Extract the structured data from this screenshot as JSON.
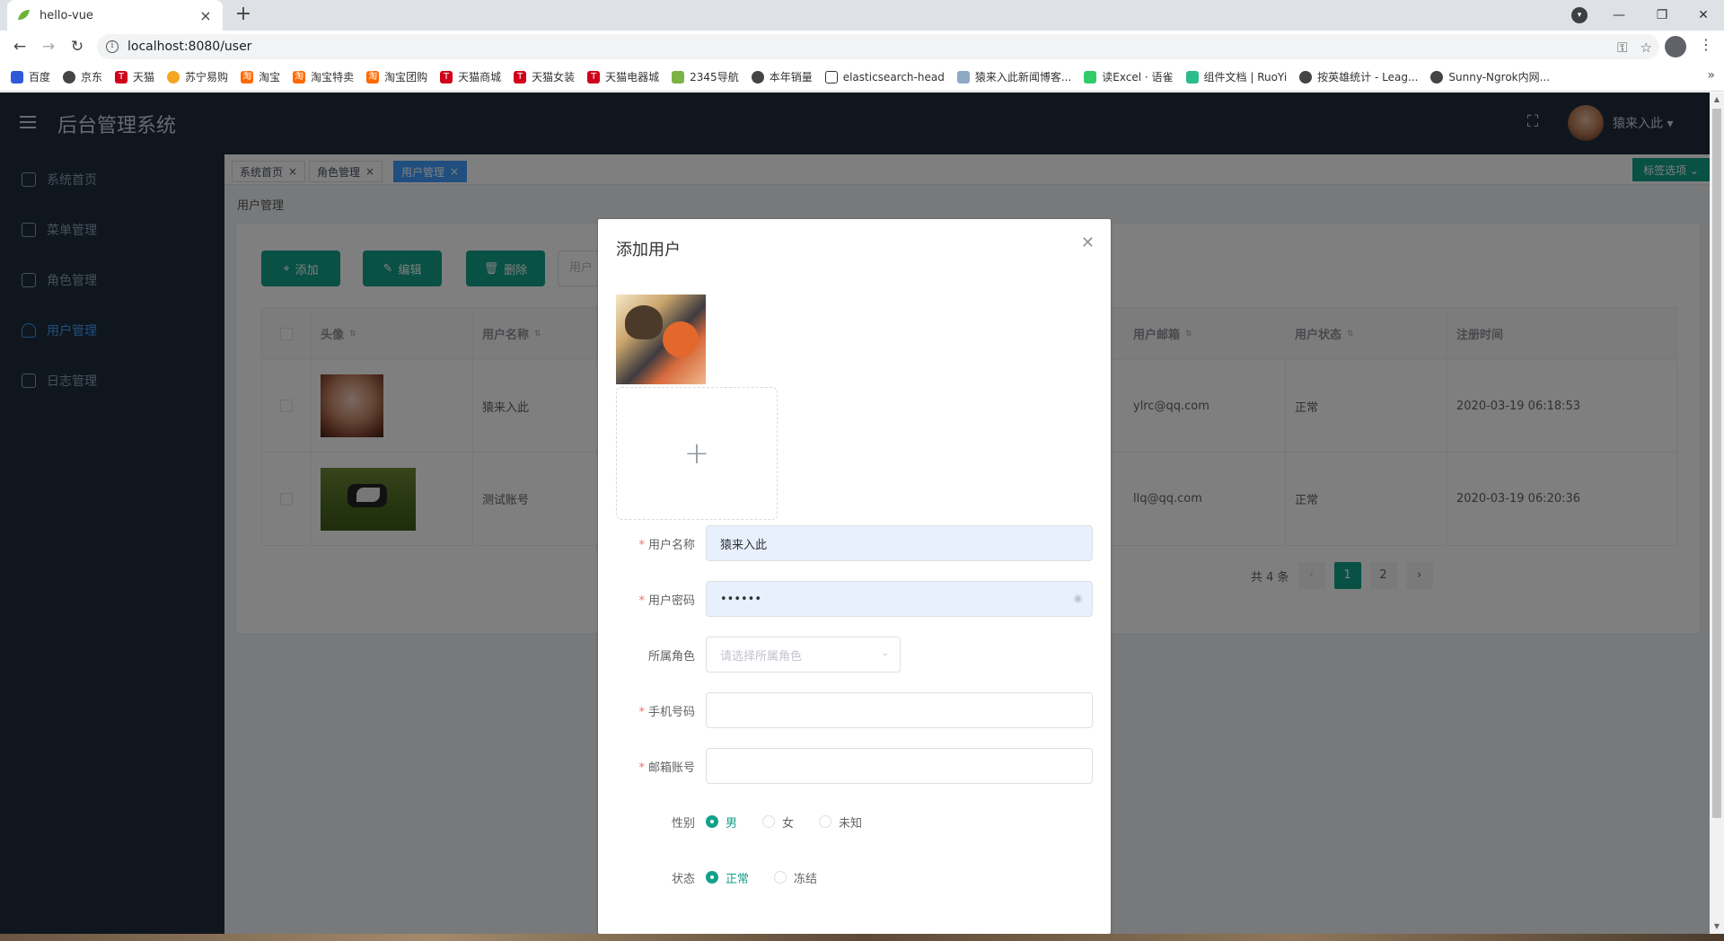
{
  "browser": {
    "tab_title": "hello-vue",
    "url": "localhost:8080/user",
    "bookmarks": [
      "百度",
      "京东",
      "天猫",
      "苏宁易购",
      "淘宝",
      "淘宝特卖",
      "淘宝团购",
      "天猫商城",
      "天猫女装",
      "天猫电器城",
      "2345导航",
      "本年销量",
      "elasticsearch-head",
      "猿来入此新闻博客...",
      "读Excel · 语雀",
      "组件文档 | RuoYi",
      "按英雄统计 - Leag...",
      "Sunny-Ngrok内网..."
    ]
  },
  "app": {
    "title": "后台管理系统",
    "user_name": "猿来入此 ▾"
  },
  "sidebar": {
    "items": [
      {
        "label": "系统首页"
      },
      {
        "label": "菜单管理"
      },
      {
        "label": "角色管理"
      },
      {
        "label": "用户管理"
      },
      {
        "label": "日志管理"
      }
    ]
  },
  "tags": {
    "items": [
      {
        "label": "系统首页"
      },
      {
        "label": "角色管理"
      },
      {
        "label": "用户管理"
      }
    ],
    "options_label": "标签选项 ⌄"
  },
  "page": {
    "breadcrumb": "用户管理",
    "buttons": {
      "add": "添加",
      "edit": "编辑",
      "delete": "删除"
    },
    "search_stub": "用户",
    "table": {
      "headers": [
        "头像",
        "用户名称",
        "用户邮箱",
        "用户状态",
        "注册时间"
      ],
      "rows": [
        {
          "name": "猿来入此",
          "email": "ylrc@qq.com",
          "status": "正常",
          "time": "2020-03-19 06:18:53"
        },
        {
          "name": "测试账号",
          "email": "llq@qq.com",
          "status": "正常",
          "time": "2020-03-19 06:20:36"
        }
      ]
    },
    "pagination": {
      "total": "共 4 条",
      "pages": [
        "1",
        "2"
      ],
      "current": "1"
    }
  },
  "dialog": {
    "title": "添加用户",
    "fields": {
      "username": {
        "label": "用户名称",
        "value": "猿来入此"
      },
      "password": {
        "label": "用户密码",
        "value": "••••••"
      },
      "role": {
        "label": "所属角色",
        "placeholder": "请选择所属角色"
      },
      "phone": {
        "label": "手机号码",
        "value": ""
      },
      "email": {
        "label": "邮箱账号",
        "value": ""
      },
      "gender": {
        "label": "性别",
        "options": [
          "男",
          "女",
          "未知"
        ],
        "selected": "男"
      },
      "status": {
        "label": "状态",
        "options": [
          "正常",
          "冻结"
        ],
        "selected": "正常"
      }
    }
  },
  "colors": {
    "accent": "#13a18a",
    "active_blue": "#409eff",
    "header_bg": "#1f2d3d"
  }
}
